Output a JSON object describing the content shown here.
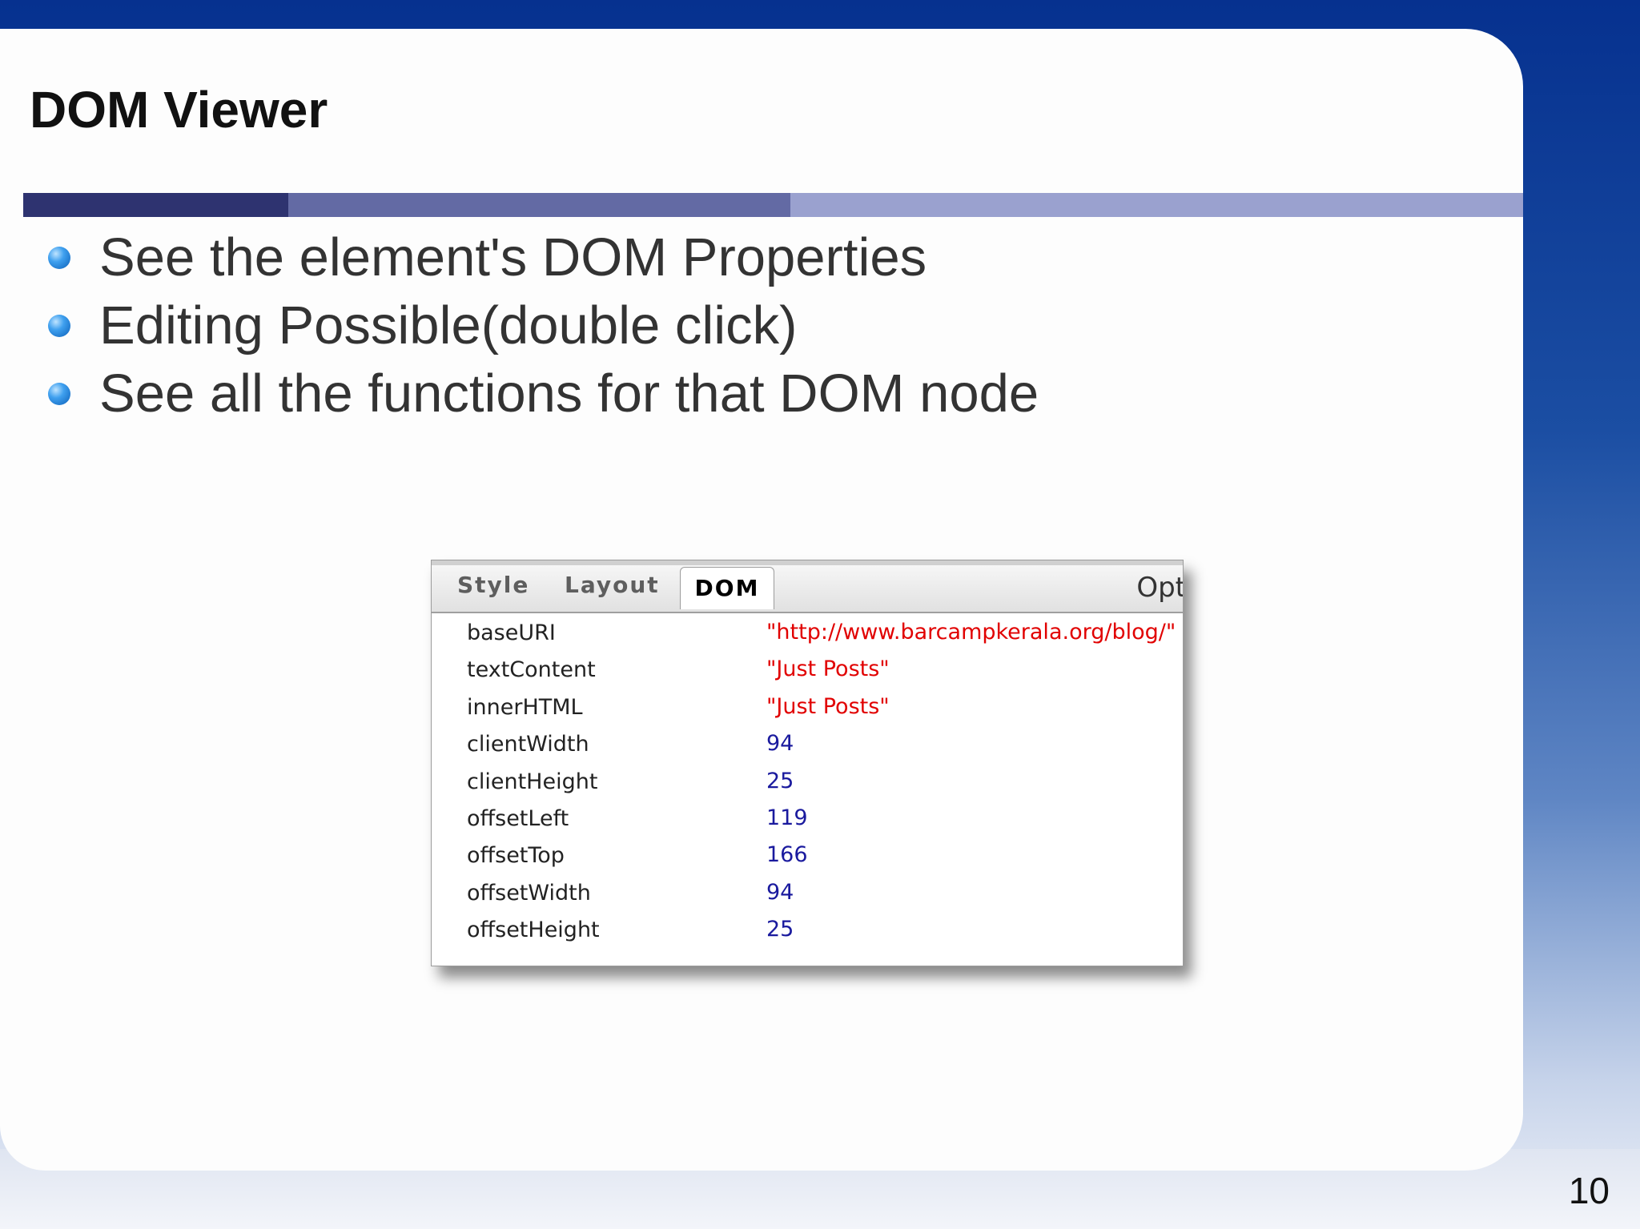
{
  "slide": {
    "title": "DOM Viewer",
    "bullets": [
      "See the element's DOM Properties",
      "Editing Possible(double click)",
      "See all the functions for that DOM node"
    ],
    "page_number": "10"
  },
  "dom_panel": {
    "tabs": [
      {
        "label": "Style",
        "active": false
      },
      {
        "label": "Layout",
        "active": false
      },
      {
        "label": "DOM",
        "active": true
      }
    ],
    "options_label": "Opt",
    "properties": [
      {
        "name": "baseURI",
        "value": "\"http://www.barcampkerala.org/blog/\"",
        "type": "string"
      },
      {
        "name": "textContent",
        "value": "\"Just Posts\"",
        "type": "string"
      },
      {
        "name": "innerHTML",
        "value": "\"Just Posts\"",
        "type": "string"
      },
      {
        "name": "clientWidth",
        "value": "94",
        "type": "number"
      },
      {
        "name": "clientHeight",
        "value": "25",
        "type": "number"
      },
      {
        "name": "offsetLeft",
        "value": "119",
        "type": "number"
      },
      {
        "name": "offsetTop",
        "value": "166",
        "type": "number"
      },
      {
        "name": "offsetWidth",
        "value": "94",
        "type": "number"
      },
      {
        "name": "offsetHeight",
        "value": "25",
        "type": "number"
      }
    ]
  },
  "colors": {
    "string_value": "#e10000",
    "number_value": "#1a1a9e",
    "bullet": "#3fa0ef",
    "frame_blue": "#06318f"
  }
}
